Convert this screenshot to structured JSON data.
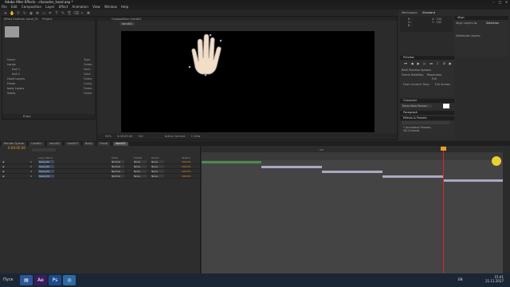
{
  "window": {
    "title": "Adobe After Effects - character_hand.aep *"
  },
  "menu": [
    "File",
    "Edit",
    "Composition",
    "Layer",
    "Effect",
    "Animation",
    "View",
    "Window",
    "Help"
  ],
  "project_panel": {
    "tabs": [
      "Effect Controls: hand_01",
      "Project"
    ],
    "items": [
      {
        "name": "hands",
        "type": "Folder"
      },
      {
        "name": "Null 1",
        "type": "Solid"
      },
      {
        "name": "Null 2",
        "type": "Solid"
      },
      {
        "name": "Hand Layers",
        "type": "Folder"
      },
      {
        "name": "Finnal",
        "type": "Comp"
      },
      {
        "name": "body Layers",
        "type": "Folder"
      },
      {
        "name": "Solids",
        "type": "Folder"
      }
    ],
    "col_name": "Name",
    "col_type": "Type",
    "bpc": "8 bpc"
  },
  "comp_panel": {
    "tab": "Composition: hand01",
    "breadcrumb": "hand01",
    "zoom": "50%",
    "timecode": "0:00:05:00",
    "quality": "Full",
    "camera": "Active Camera",
    "views": "1 View"
  },
  "right_panel": {
    "info": {
      "title": "Workspace:",
      "value": "Standard",
      "r": "R :",
      "g": "G :",
      "b": "B :",
      "x": "X : 234",
      "y": "Y : 292"
    },
    "align": {
      "title": "Align",
      "label": "Align Layers to:",
      "value": "Selection",
      "dist": "Distribute Layers:"
    },
    "preview": {
      "title": "Preview",
      "ram": "RAM Preview Options",
      "frame_rate": "Frame Rate",
      "skip": "Skip",
      "resolution": "Resolution",
      "res_value": "Full",
      "from": "From Current Time",
      "full": "Full Screen"
    },
    "character": {
      "title": "Character",
      "font": "Times New Roman"
    },
    "paragraph": {
      "title": "Paragraph"
    },
    "effects": {
      "title": "Effects & Presets",
      "items": [
        "* Animation Presets",
        "3D Channel"
      ]
    }
  },
  "timeline": {
    "tabs": [
      "Render Queue",
      "hand01",
      "hand02",
      "hand03",
      "Body",
      "Finnal",
      "hand01"
    ],
    "timecode": "0:00:05:00",
    "headers": {
      "name": "Layer Name",
      "mode": "Mode",
      "trkmat": "TrkMat",
      "parent": "Parent",
      "stretch": "Stretch"
    },
    "layers": [
      {
        "no": "1",
        "name": "hand_01",
        "mode": "Normal",
        "trkmat": "None",
        "parent": "None",
        "stretch": "100.0%"
      },
      {
        "no": "2",
        "name": "hand_02",
        "mode": "Normal",
        "trkmat": "None",
        "parent": "None",
        "stretch": "100.0%"
      },
      {
        "no": "3",
        "name": "hand_03",
        "mode": "Normal",
        "trkmat": "None",
        "parent": "None",
        "stretch": "100.0%"
      },
      {
        "no": "4",
        "name": "hand_04",
        "mode": "Normal",
        "trkmat": "None",
        "parent": "None",
        "stretch": "100.0%"
      }
    ],
    "ruler_label": "00f"
  },
  "taskbar": {
    "lang": "EN",
    "time": "15:41",
    "date": "21.11.2017",
    "start": "Пуск"
  }
}
